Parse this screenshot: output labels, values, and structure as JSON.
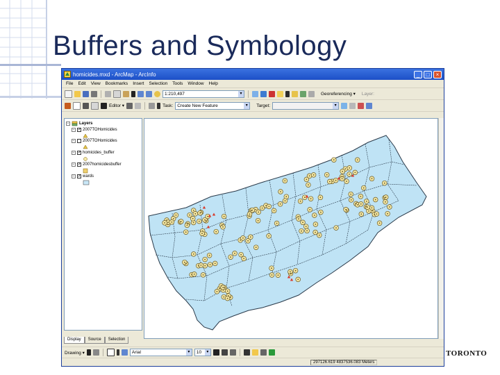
{
  "slide": {
    "title": "Buffers and Symbology",
    "logo_text": "TORONTO"
  },
  "window": {
    "title": "homicides.mxd - ArcMap - ArcInfo",
    "buttons": [
      "minimize",
      "maximize",
      "close"
    ]
  },
  "menu": [
    "File",
    "Edit",
    "View",
    "Bookmarks",
    "Insert",
    "Selection",
    "Tools",
    "Window",
    "Help"
  ],
  "standard_toolbar": {
    "scale_value": "1:210,497",
    "georeferencing_label": "Georeferencing ▾",
    "layer_label": "Layer:"
  },
  "editor_toolbar": {
    "editor_label": "Editor ▾",
    "task_label": "Task:",
    "task_value": "Create New Feature",
    "target_label": "Target:"
  },
  "toc": {
    "root": "Layers",
    "layers": [
      {
        "name": "2007TOHomicides",
        "checked": true,
        "symbol_color": "#e8c84a"
      },
      {
        "name": "2007TOHomicides",
        "checked": false,
        "symbol_color": "#e8c84a"
      },
      {
        "name": "homicides_buffer",
        "checked": true,
        "symbol_color": "#f5e9a8"
      },
      {
        "name": "2007homicidesbuffer",
        "checked": true,
        "symbol_color": "#f0d070"
      },
      {
        "name": "wards",
        "checked": true,
        "symbol_color": "#c9e7f7"
      }
    ],
    "tabs": [
      "Display",
      "Source",
      "Selection"
    ],
    "active_tab": "Display"
  },
  "drawing_toolbar": {
    "label": "Drawing ▾",
    "font_value": "Arial",
    "font_size": "10"
  },
  "status": {
    "coordinates": "297126.619 4837536.083 Meters"
  },
  "colors": {
    "map_fill": "#bfe3f5",
    "buffer_fill": "#f3e6a3",
    "buffer_edge": "#6b5a25",
    "homicide_red": "#d83a2a",
    "titlebar": "#2156cf",
    "slide_title": "#1a2a5a"
  }
}
